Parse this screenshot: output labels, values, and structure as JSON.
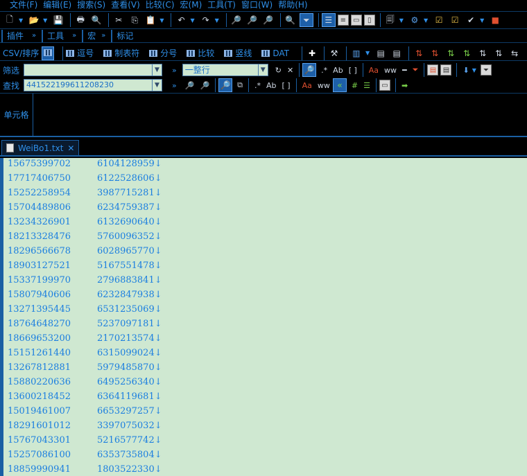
{
  "menu": [
    "文件(F)",
    "编辑(E)",
    "搜索(S)",
    "查看(V)",
    "比较(C)",
    "宏(M)",
    "工具(T)",
    "窗口(W)",
    "帮助(H)"
  ],
  "pluginbar": {
    "plugins_label": "插件",
    "tools_label": "工具",
    "macro_label": "宏",
    "marker_label": "标记"
  },
  "csvbar": {
    "csv_sort_label": "CSV/排序",
    "comma_label": "逗号",
    "tab_label": "制表符",
    "semicolon_label": "分号",
    "compare_label": "比较",
    "pipe_label": "竖线",
    "dat_label": "DAT"
  },
  "filter": {
    "label": "筛选",
    "input_value": "",
    "mode_value": "一整行"
  },
  "find": {
    "label": "查找",
    "input_value": "441522199611208230"
  },
  "cell": {
    "label": "单元格"
  },
  "tab": {
    "filename": "WeiBo1.txt",
    "close": "✕"
  },
  "editor": {
    "eol_marker": "↓",
    "lines": [
      [
        "15675399702",
        "6104128959"
      ],
      [
        "17717406750",
        "6122528606"
      ],
      [
        "15252258954",
        "3987715281"
      ],
      [
        "15704489806",
        "6234759387"
      ],
      [
        "13234326901",
        "6132690640"
      ],
      [
        "18213328476",
        "5760096352"
      ],
      [
        "18296566678",
        "6028965770"
      ],
      [
        "18903127521",
        "5167551478"
      ],
      [
        "15337199970",
        "2796883841"
      ],
      [
        "15807940606",
        "6232847938"
      ],
      [
        "13271395445",
        "6531235069"
      ],
      [
        "18764648270",
        "5237097181"
      ],
      [
        "18669653200",
        "2170213574"
      ],
      [
        "15151261440",
        "6315099024"
      ],
      [
        "13267812881",
        "5979485870"
      ],
      [
        "15880220636",
        "6495256340"
      ],
      [
        "13600218452",
        "6364119681"
      ],
      [
        "15019461007",
        "6653297257"
      ],
      [
        "18291601012",
        "3397075032"
      ],
      [
        "15767043301",
        "5216577742"
      ],
      [
        "15257086100",
        "6353735804"
      ],
      [
        "18859990941",
        "1803522330"
      ]
    ]
  },
  "colors": {
    "accent": "#2f8fe8",
    "editor_bg": "#cfe8d1",
    "editor_text": "#1a7ee0",
    "chrome_bg": "#000000"
  }
}
